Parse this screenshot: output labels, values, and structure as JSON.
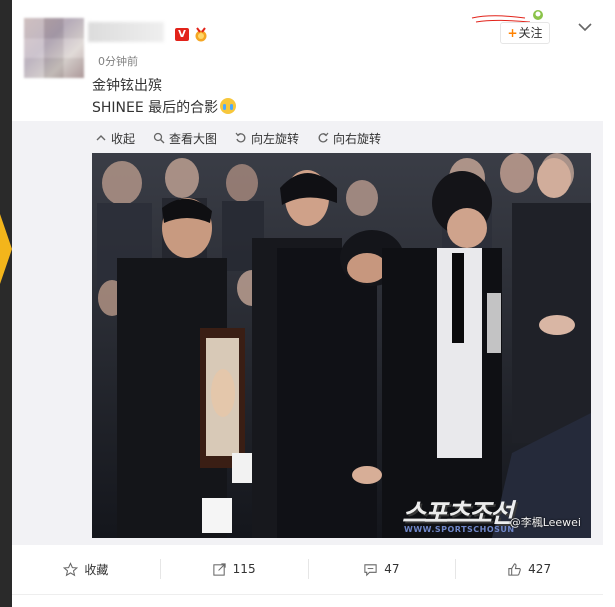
{
  "post": {
    "time": "0分钟前",
    "line1": "金钟铉出殡",
    "line2": "SHINEE 最后的合影",
    "follow_label": "关注",
    "verified_badge": "V"
  },
  "media_toolbar": {
    "collapse": "收起",
    "view_large": "查看大图",
    "rotate_left": "向左旋转",
    "rotate_right": "向右旋转"
  },
  "photo": {
    "watermark": "@李楓Leewei",
    "logo_text": "스포츠조선",
    "logo_sub": "WWW.SPORTSCHOSUN"
  },
  "actions": {
    "favorite": "收藏",
    "repost_count": "115",
    "comment_count": "47",
    "like_count": "427"
  },
  "colors": {
    "accent": "#ff8200",
    "badge_red": "#e2231a",
    "panel_bg": "#f2f2f5"
  },
  "icons": [
    "collapse-icon",
    "zoom-icon",
    "rotate-left-icon",
    "rotate-right-icon",
    "star-icon",
    "repost-icon",
    "comment-icon",
    "like-icon",
    "chevron-down-icon",
    "medal-icon",
    "cry-emoji-icon"
  ]
}
